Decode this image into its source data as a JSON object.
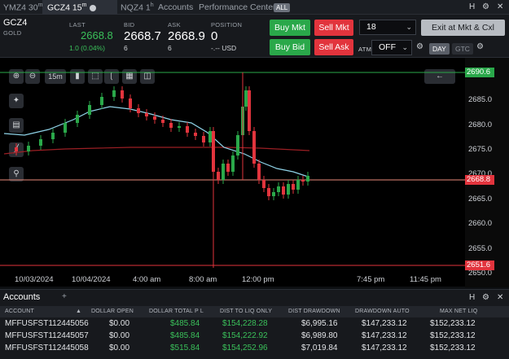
{
  "tabs": [
    {
      "label": "YMZ4 30",
      "sup": "m"
    },
    {
      "label": "GCZ4 15",
      "sup": "m"
    },
    {
      "label": "NQZ4 1",
      "sup": "h"
    },
    {
      "label": "Accounts",
      "sup": ""
    },
    {
      "label": "Performance Center",
      "sup": ""
    }
  ],
  "tabs_badge": "ALL",
  "topbar_right": [
    "H",
    "⚙",
    "✕"
  ],
  "quote": {
    "symbol": "GCZ4",
    "name": "GOLD",
    "last_label": "LAST",
    "last": "2668.8",
    "change": "1.0 (0.04%)",
    "bid_label": "BID",
    "bid": "2668.7",
    "bid_size": "6",
    "ask_label": "ASK",
    "ask": "2668.9",
    "ask_size": "6",
    "position_label": "POSITION",
    "position": "0",
    "position_sub": "-.-- USD"
  },
  "orders": {
    "buy_mkt": "Buy Mkt",
    "sell_mkt": "Sell Mkt",
    "buy_bid": "Buy Bid",
    "sell_ask": "Sell Ask",
    "qty": "18",
    "exit": "Exit at Mkt & Cxl",
    "atm_label": "ATM",
    "atm_value": "OFF",
    "day": "DAY",
    "gtc": "GTC"
  },
  "chart_toolbar": {
    "interval": "15m"
  },
  "chart_data": {
    "type": "candlestick",
    "symbol": "GCZ4",
    "interval": "15m",
    "y_ticks": [
      "2690.0",
      "2685.0",
      "2680.0",
      "2675.0",
      "2670.0",
      "2665.0",
      "2660.0",
      "2655.0",
      "2650.0"
    ],
    "ylim": [
      2650,
      2692
    ],
    "x_labels": [
      "10/03/2024",
      "10/04/2024",
      "4:00 am",
      "8:00 am",
      "12:00 pm",
      "7:45 pm",
      "11:45 pm"
    ],
    "price_tags": [
      {
        "value": "2690.6",
        "color": "#2aa84a"
      },
      {
        "value": "2668.8",
        "color": "#e2343d"
      },
      {
        "value": "2651.6",
        "color": "#e2343d"
      }
    ]
  },
  "accounts": {
    "tab_label": "Accounts",
    "add": "+",
    "columns": [
      "ACCOUNT",
      "DOLLAR OPEN",
      "DOLLAR TOTAL P L",
      "DIST TO LIQ ONLY",
      "DIST DRAWDOWN",
      "DRAWDOWN AUTO",
      "MAX NET LIQ"
    ],
    "rows": [
      [
        "MFFUSFST112445056",
        "$0.00",
        "$485.84",
        "$154,228.28",
        "$6,995.16",
        "$147,233.12",
        "$152,233.12"
      ],
      [
        "MFFUSFST112445057",
        "$0.00",
        "$485.84",
        "$154,222.92",
        "$6,989.80",
        "$147,233.12",
        "$152,233.12"
      ],
      [
        "MFFUSFST112445058",
        "$0.00",
        "$515.84",
        "$154,252.96",
        "$7,019.84",
        "$147,233.12",
        "$152,233.12"
      ]
    ]
  }
}
